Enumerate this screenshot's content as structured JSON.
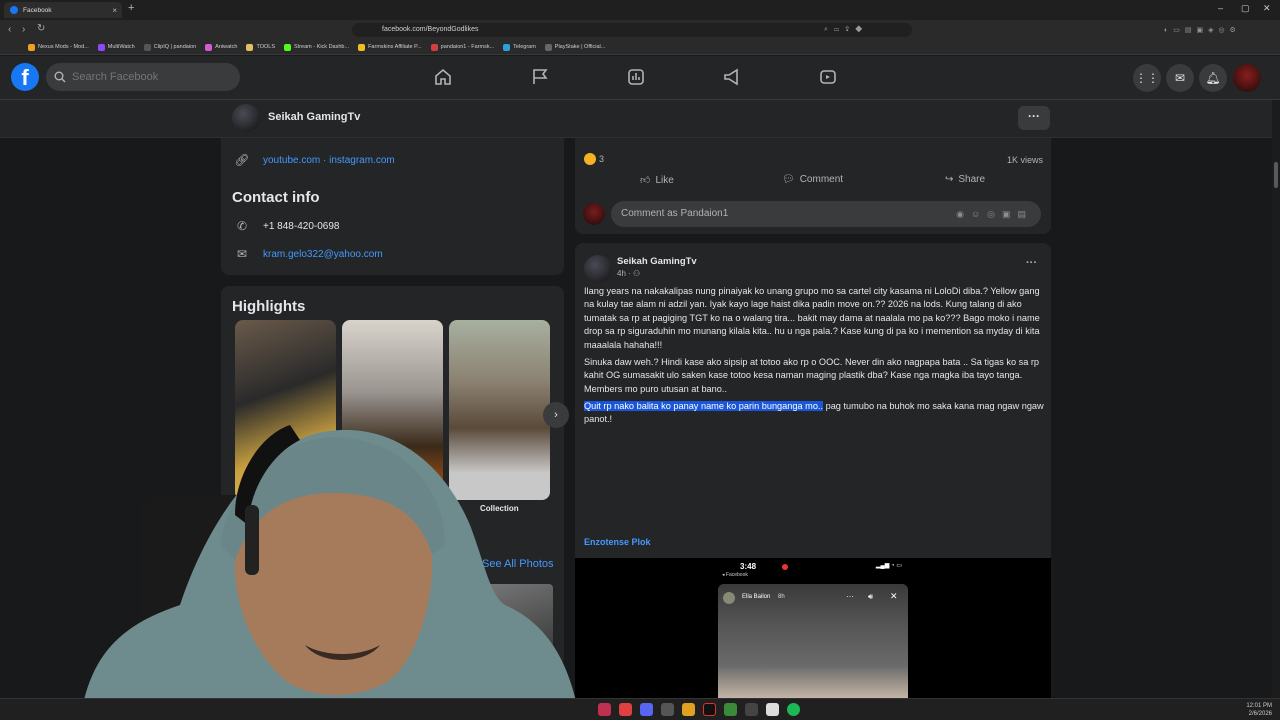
{
  "browser": {
    "tab_title": "Facebook",
    "url": "facebook.com/BeyondGodlikes",
    "new_tab": "+",
    "bookmarks": [
      {
        "label": "Nexus Mods - Mod...",
        "color": "#f0a020"
      },
      {
        "label": "MultiWatch",
        "color": "#9146ff"
      },
      {
        "label": "ClipIQ | pandaion",
        "color": "#2d2d2d"
      },
      {
        "label": "Aniwatch",
        "color": "#d35bd3"
      },
      {
        "label": "TOOLS",
        "color": "#e0c060"
      },
      {
        "label": "Stream - Kick Dashb...",
        "color": "#53fc18"
      },
      {
        "label": "Farmskins Affiliate P...",
        "color": "#f0c020"
      },
      {
        "label": "pandaion1 - Farmsk...",
        "color": "#d04040"
      },
      {
        "label": "Telegram",
        "color": "#2aa1da"
      },
      {
        "label": "PlayStake | Official...",
        "color": "#666666"
      }
    ]
  },
  "fb": {
    "search_placeholder": "Search Facebook",
    "brand_color": "#1877f2"
  },
  "profile": {
    "name": "Seikah GamingTv",
    "links": "youtube.com · instagram.com",
    "contact_title": "Contact info",
    "phone": "+1 848-420-0698",
    "email": "kram.gelo322@yahoo.com",
    "highlights_title": "Highlights",
    "highlight_label": "Collection",
    "see_all_photos": "See All Photos"
  },
  "post_top": {
    "reaction_count": "3",
    "views": "1K views",
    "like": "Like",
    "comment": "Comment",
    "share": "Share",
    "comment_placeholder": "Comment as Pandaion1"
  },
  "post": {
    "author": "Seikah GamingTv",
    "time": "4h · ",
    "p1": "Ilang years na nakakalipas nung pinaiyak ko unang grupo mo sa cartel  city kasama ni LoloDi diba.? Yellow gang na kulay tae alam ni adzil yan. Iyak kayo lage haist dika padin move on.?? 2026 na lods. Kung talang di ako tumatak sa rp at pagiging TGT ko na o walang tira... bakit may dama at naalala mo pa ko??? Bago moko i name drop sa rp siguraduhin mo munang kilala kita.. hu u nga pala.? Kase kung di pa ko i memention sa myday di kita maaalala hahaha!!!",
    "p2": "Sinuka daw weh.? Hindi kase ako sipsip at totoo ako rp o OOC. Never din ako nagpapa bata .. Sa tigas ko sa rp kahit OG sumasakit ulo saken kase totoo kesa naman maging plastik dba? Kase nga magka iba tayo tanga. Members mo puro  utusan at bano..",
    "p3_highlight": "Quit rp nako balita ko panay name ko parin bunganga mo..",
    "p3_rest": " pag tumubo na buhok mo saka kana mag ngaw ngaw panot.!",
    "see_translation": "Enzotense Plok"
  },
  "video": {
    "status_time": "3:48",
    "status_app": "◂ Facebook",
    "story_user": "Ella Bailon",
    "story_time": "8h"
  },
  "tray": {
    "time": "12:01 PM",
    "date": "2/6/2026"
  }
}
